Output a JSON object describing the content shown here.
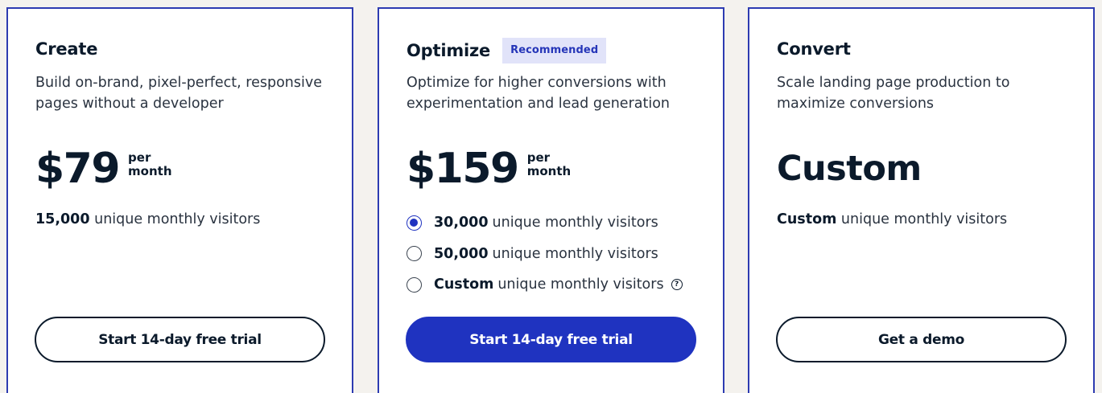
{
  "colors": {
    "page_background": "#f4f2ee",
    "card_border": "#2d3bb1",
    "accent": "#1f33c0",
    "badge_background": "#e1e3f9",
    "text": "#0b1a2b"
  },
  "plans": [
    {
      "title": "Create",
      "description": "Build on-brand, pixel-perfect, responsive pages without a developer",
      "price": "$79",
      "price_period": "per month",
      "visitors_count": "15,000",
      "visitors_text": "unique monthly visitors",
      "cta": "Start 14-day free trial"
    },
    {
      "title": "Optimize",
      "badge": "Recommended",
      "description": "Optimize for higher conversions with experimentation and lead generation",
      "price": "$159",
      "price_period": "per month",
      "visitor_options": [
        {
          "count": "30,000",
          "text": "unique monthly visitors",
          "selected": true
        },
        {
          "count": "50,000",
          "text": "unique monthly visitors",
          "selected": false
        },
        {
          "count": "Custom",
          "text": "unique monthly visitors",
          "selected": false,
          "icon": "help-icon"
        }
      ],
      "help_icon_glyph": "?",
      "cta": "Start 14-day free trial"
    },
    {
      "title": "Convert",
      "description": "Scale landing page production to maximize conversions",
      "price": "Custom",
      "visitors_count": "Custom",
      "visitors_text": "unique monthly visitors",
      "cta": "Get a demo"
    }
  ]
}
